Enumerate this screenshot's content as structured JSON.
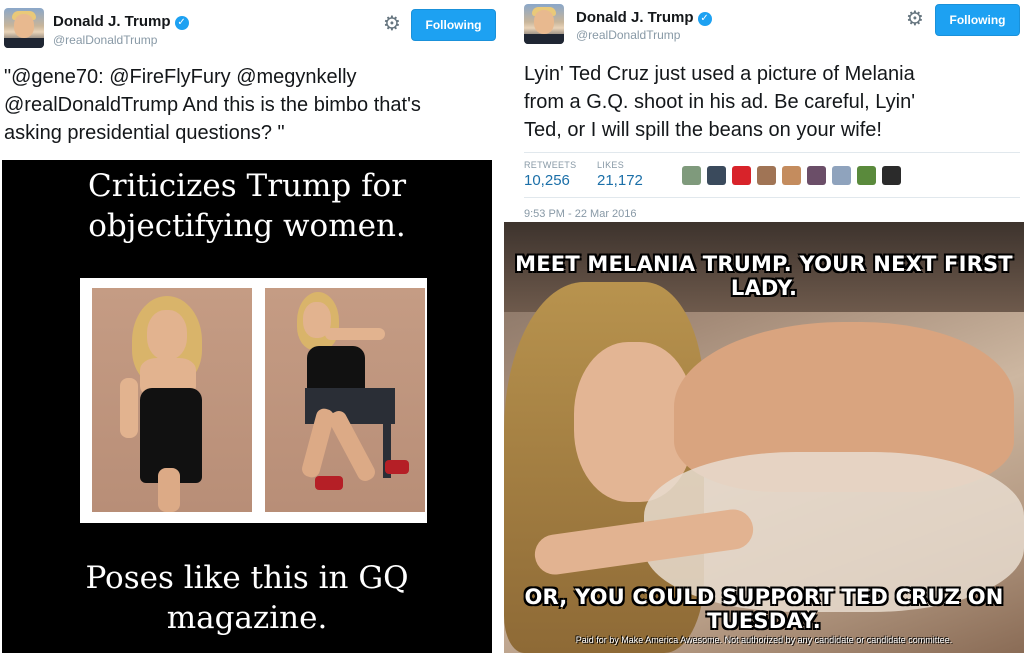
{
  "left_tweet": {
    "author_name": "Donald J. Trump",
    "handle": "@realDonaldTrump",
    "follow_label": "Following",
    "text_lines": [
      "\"@gene70: @FireFlyFury @megynkelly",
      "@realDonaldTrump And this is the bimbo that's",
      "asking presidential questions? \""
    ],
    "meme": {
      "top_lines": [
        "Criticizes Trump for",
        "objectifying women."
      ],
      "bottom_lines": [
        "Poses like this in GQ",
        "magazine."
      ]
    }
  },
  "right_tweet": {
    "author_name": "Donald J. Trump",
    "handle": "@realDonaldTrump",
    "follow_label": "Following",
    "text_lines": [
      "Lyin' Ted Cruz just used a picture of Melania",
      "from a G.Q. shoot in his ad. Be careful, Lyin'",
      "Ted, or I will spill the beans on your wife!"
    ],
    "retweets_label": "RETWEETS",
    "retweets_value": "10,256",
    "likes_label": "LIKES",
    "likes_value": "21,172",
    "liker_colors": [
      "#7f9a7c",
      "#3a4a5c",
      "#d8232a",
      "#a07455",
      "#c48c5e",
      "#6b4e68",
      "#8fa3bd",
      "#5a8a3c",
      "#2b2b2b"
    ],
    "timestamp": "9:53 PM - 22 Mar 2016",
    "meme": {
      "top_text": "MEET MELANIA TRUMP. YOUR NEXT FIRST LADY.",
      "bottom_text": "OR, YOU COULD SUPPORT TED CRUZ ON TUESDAY.",
      "fine_print": "Paid for by Make America Awesome. Not authorized by any candidate or candidate committee."
    }
  },
  "colors": {
    "follow_button": "#1da1f2",
    "verified_badge": "#1da1f2",
    "stat_value": "#1b6fa8",
    "muted_text": "#8899a6"
  }
}
